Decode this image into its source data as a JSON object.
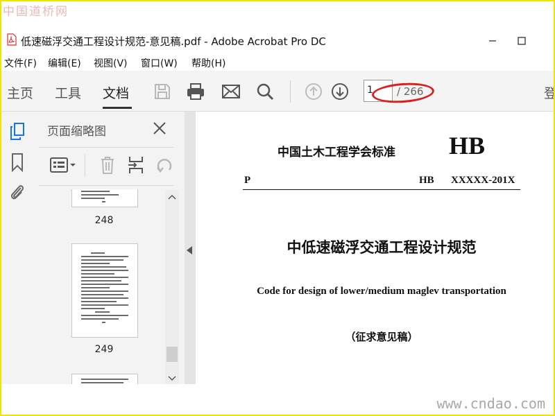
{
  "watermarks": {
    "top": "中国道桥网",
    "bottom": "www.cndao.com"
  },
  "window": {
    "title": "低速磁浮交通工程设计规范-意见稿.pdf - Adobe Acrobat Pro DC",
    "minimize_icon": "minimize-icon",
    "maximize_icon": "maximize-icon"
  },
  "menu": [
    "文件(F)",
    "编辑(E)",
    "视图(V)",
    "窗口(W)",
    "帮助(H)"
  ],
  "toolbar": {
    "tabs": [
      "主页",
      "工具",
      "文档"
    ],
    "active_tab": "文档",
    "icons": [
      "save-icon",
      "print-icon",
      "email-icon",
      "search-icon",
      "prev-page-icon",
      "next-page-icon"
    ],
    "page_current": "1",
    "page_total": "/ 266",
    "login": "登"
  },
  "left_strip": {
    "icons": [
      "page-thumbnails-icon",
      "bookmarks-icon",
      "attachments-icon"
    ]
  },
  "thumbnail_panel": {
    "title": "页面缩略图",
    "tools": [
      "thumbnail-options-icon",
      "delete-page-icon",
      "insert-page-icon",
      "rotate-page-icon"
    ],
    "pages": [
      {
        "label": "248"
      },
      {
        "label": "249"
      }
    ]
  },
  "document": {
    "org": "中国土木工程学会标准",
    "hb": "HB",
    "p": "P",
    "hb_small": "HB",
    "code": "XXXXX-201X",
    "title_cn": "中低速磁浮交通工程设计规范",
    "title_en": "Code for design of lower/medium maglev transportation",
    "draft": "（征求意见稿）"
  },
  "colors": {
    "annotation": "#d82020",
    "frame": "#f2e400",
    "active_strip_icon": "#1473e6"
  }
}
